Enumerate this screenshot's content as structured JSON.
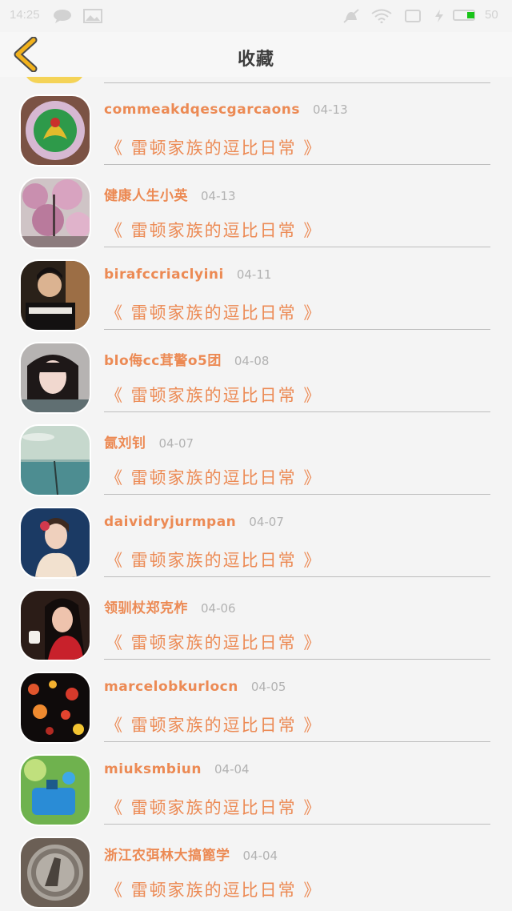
{
  "status_bar": {
    "time": "14:25",
    "battery_level": "50",
    "battery_color": "#19c419"
  },
  "header": {
    "title": "收藏",
    "back_icon": "chevron-left-icon",
    "back_color": "#f2b21c"
  },
  "favorites": [
    {
      "name": "commeakdqescgarcaons",
      "date": "04-13",
      "book": "《 雷顿家族的逗比日常 》",
      "avatar": "dragon-emblem"
    },
    {
      "name": "健康人生小英",
      "date": "04-13",
      "book": "《 雷顿家族的逗比日常 》",
      "avatar": "cherry-blossom"
    },
    {
      "name": "birafccriaclyini",
      "date": "04-11",
      "book": "《 雷顿家族的逗比日常 》",
      "avatar": "young-man"
    },
    {
      "name": "blo侮cc茸警o5团",
      "date": "04-08",
      "book": "《 雷顿家族的逗比日常 》",
      "avatar": "girl-portrait"
    },
    {
      "name": "氤刘钊",
      "date": "04-07",
      "book": "《 雷顿家族的逗比日常 》",
      "avatar": "seascape"
    },
    {
      "name": "daividryjurmpan",
      "date": "04-07",
      "book": "《 雷顿家族的逗比日常 》",
      "avatar": "woman-with-flower"
    },
    {
      "name": "领驯杖郑克柞",
      "date": "04-06",
      "book": "《 雷顿家族的逗比日常 》",
      "avatar": "girl-with-cup"
    },
    {
      "name": "marcelobkurlocn",
      "date": "04-05",
      "book": "《 雷顿家族的逗比日常 》",
      "avatar": "bokeh-hearts"
    },
    {
      "name": "miuksmbiun",
      "date": "04-04",
      "book": "《 雷顿家族的逗比日常 》",
      "avatar": "blue-bottle"
    },
    {
      "name": "浙江农弭林大搞篦学",
      "date": "04-04",
      "book": "《 雷顿家族的逗比日常 》",
      "avatar": "silver-coin"
    }
  ]
}
